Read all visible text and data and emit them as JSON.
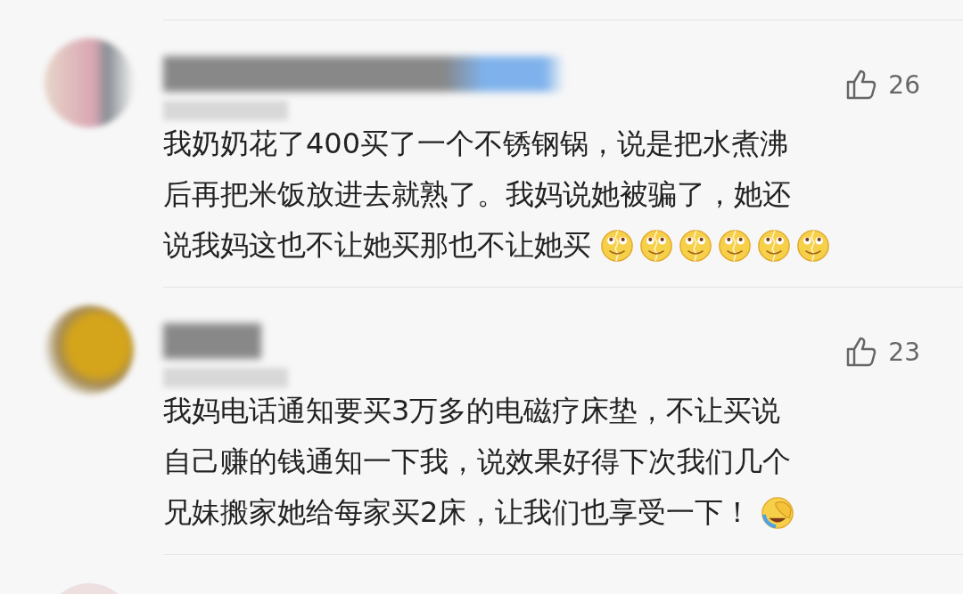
{
  "comments": [
    {
      "likes": "26",
      "lines": [
        "我奶奶花了400买了一个不锈钢锅，说是把水煮沸",
        "后再把米饭放进去就熟了。我妈说她被骗了，她还",
        "说我妈这也不让她买那也不让她买"
      ],
      "emojis": [
        {
          "kind": "broken-smile"
        },
        {
          "kind": "broken-smile"
        },
        {
          "kind": "broken-smile"
        },
        {
          "kind": "broken-smile"
        },
        {
          "kind": "broken-smile"
        },
        {
          "kind": "broken-smile"
        }
      ]
    },
    {
      "likes": "23",
      "lines": [
        "我妈电话通知要买3万多的电磁疗床垫，不让买说",
        "自己赚的钱通知一下我，说效果好得下次我们几个",
        "兄妹搬家她给每家买2床，让我们也享受一下！"
      ],
      "emojis": [
        {
          "kind": "facepalm-cry"
        }
      ]
    }
  ]
}
